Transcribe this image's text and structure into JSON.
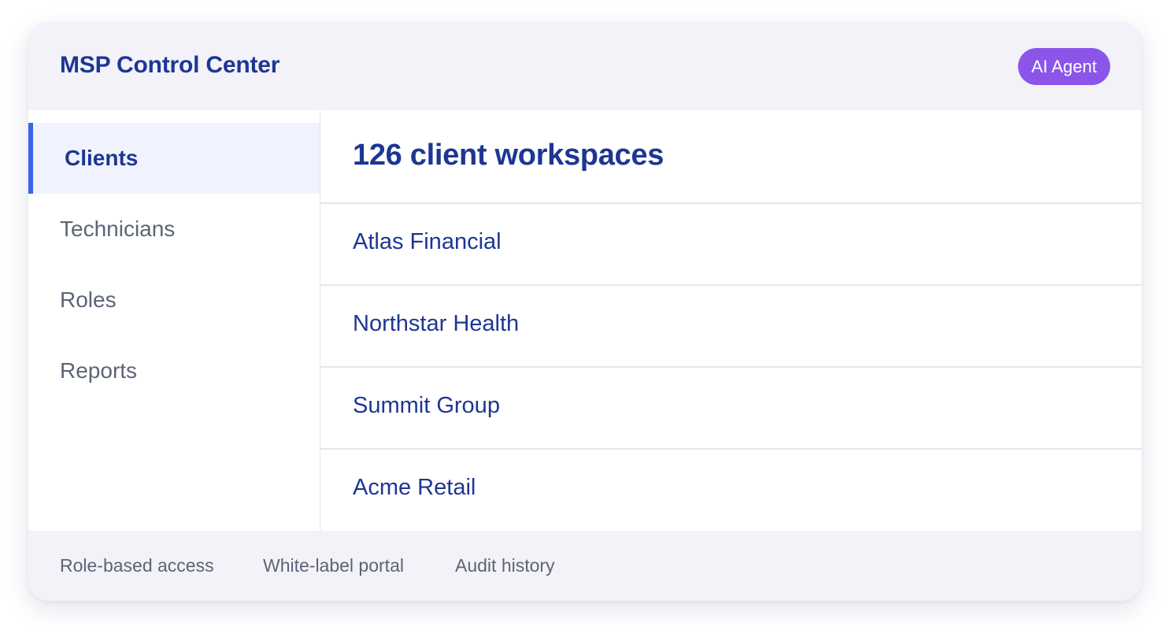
{
  "header": {
    "title": "MSP Control Center",
    "ai_badge": "AI Agent"
  },
  "sidebar": {
    "items": [
      {
        "label": "Clients",
        "active": true
      },
      {
        "label": "Technicians",
        "active": false
      },
      {
        "label": "Roles",
        "active": false
      },
      {
        "label": "Reports",
        "active": false
      }
    ]
  },
  "main": {
    "title": "126 client workspaces",
    "clients": [
      {
        "name": "Atlas Financial"
      },
      {
        "name": "Northstar Health"
      },
      {
        "name": "Summit Group"
      },
      {
        "name": "Acme Retail"
      }
    ]
  },
  "footer": {
    "links": [
      {
        "label": "Role-based access"
      },
      {
        "label": "White-label portal"
      },
      {
        "label": "Audit history"
      }
    ]
  },
  "colors": {
    "brand_navy": "#1e3693",
    "ai_purple": "#8b55ea",
    "active_indicator": "#3b63e6",
    "header_bg": "#f2f2f8"
  }
}
